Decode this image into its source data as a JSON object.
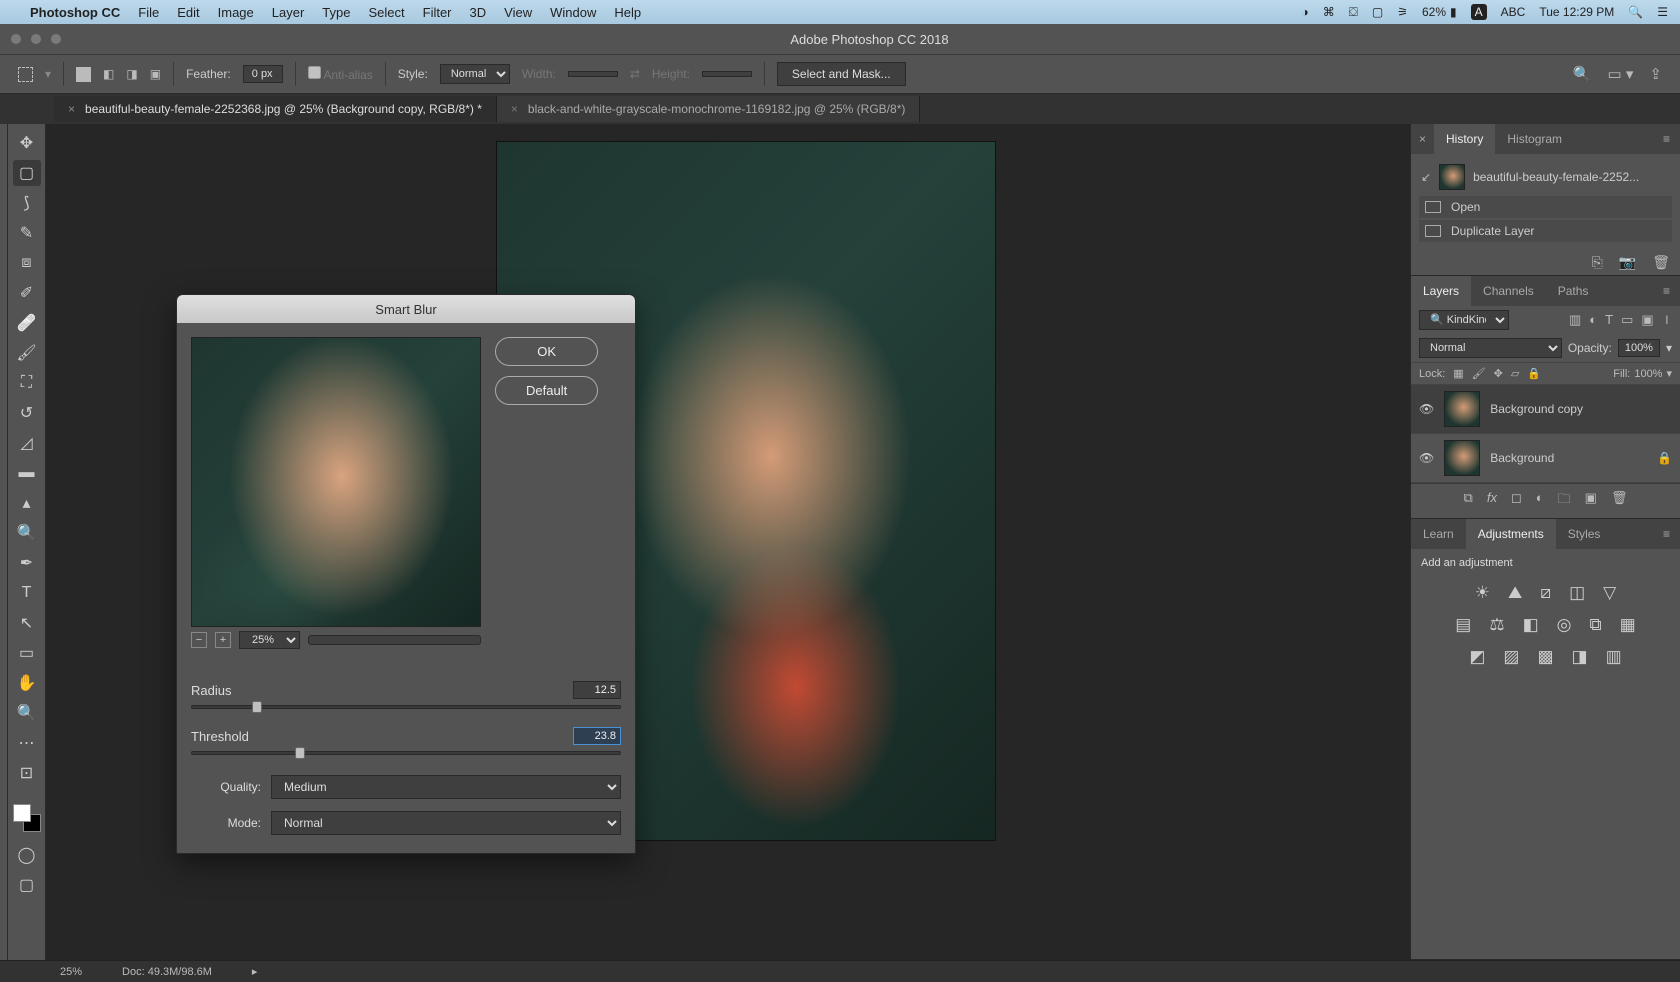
{
  "mac_menu": {
    "app": "Photoshop CC",
    "items": [
      "File",
      "Edit",
      "Image",
      "Layer",
      "Type",
      "Select",
      "Filter",
      "3D",
      "View",
      "Window",
      "Help"
    ],
    "battery": "62%",
    "input": "ABC",
    "clock": "Tue 12:29 PM"
  },
  "titlebar": {
    "title": "Adobe Photoshop CC 2018"
  },
  "options_bar": {
    "feather_label": "Feather:",
    "feather_value": "0 px",
    "antialias_label": "Anti-alias",
    "style_label": "Style:",
    "style_value": "Normal",
    "width_label": "Width:",
    "height_label": "Height:",
    "select_mask": "Select and Mask..."
  },
  "doc_tabs": [
    {
      "label": "beautiful-beauty-female-2252368.jpg @ 25% (Background copy, RGB/8*) *",
      "active": true
    },
    {
      "label": "black-and-white-grayscale-monochrome-1169182.jpg @ 25% (RGB/8*)",
      "active": false
    }
  ],
  "dialog": {
    "title": "Smart Blur",
    "ok": "OK",
    "default": "Default",
    "zoom": "25%",
    "radius_label": "Radius",
    "radius_value": "12.5",
    "radius_pct": 14,
    "threshold_label": "Threshold",
    "threshold_value": "23.8",
    "threshold_pct": 24,
    "quality_label": "Quality:",
    "quality_value": "Medium",
    "mode_label": "Mode:",
    "mode_value": "Normal"
  },
  "panels": {
    "history": {
      "tab1": "History",
      "tab2": "Histogram",
      "filename": "beautiful-beauty-female-2252...",
      "items": [
        "Open",
        "Duplicate Layer"
      ]
    },
    "layers": {
      "tab1": "Layers",
      "tab2": "Channels",
      "tab3": "Paths",
      "kind": "Kind",
      "blend": "Normal",
      "opacity_label": "Opacity:",
      "opacity_value": "100%",
      "lock_label": "Lock:",
      "fill_label": "Fill:",
      "fill_value": "100%",
      "rows": [
        {
          "name": "Background copy",
          "locked": false
        },
        {
          "name": "Background",
          "locked": true
        }
      ]
    },
    "adjustments": {
      "tab1": "Learn",
      "tab2": "Adjustments",
      "tab3": "Styles",
      "heading": "Add an adjustment"
    }
  },
  "status": {
    "zoom": "25%",
    "doc": "Doc: 49.3M/98.6M"
  }
}
